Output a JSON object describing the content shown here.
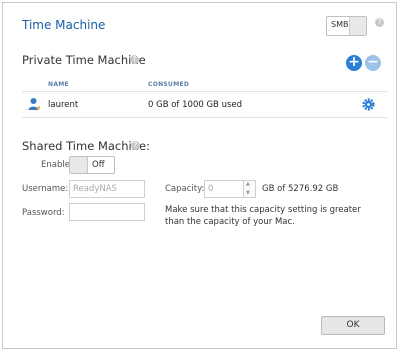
{
  "window": {
    "title": "Time Machine"
  },
  "protocol_toggle": {
    "label": "SMB",
    "help": "?"
  },
  "private": {
    "title": "Private Time Machine",
    "help": "?",
    "add_symbol": "+",
    "remove_symbol": "−",
    "columns": [
      "NAME",
      "CONSUMED"
    ],
    "rows": [
      {
        "name": "laurent",
        "consumed": "0 GB of 1000 GB used"
      }
    ]
  },
  "shared": {
    "title": "Shared Time Machine:",
    "help": "?",
    "enable_label": "Enable",
    "enable_state": "Off",
    "username_label": "Username:",
    "username_value": "ReadyNAS",
    "password_label": "Password:",
    "password_value": "",
    "capacity_label": "Capacity:",
    "capacity_value": "0",
    "capacity_suffix": "GB of 5276.92 GB",
    "note": "Make sure that this capacity setting is greater than the capacity of your Mac."
  },
  "footer": {
    "ok_label": "OK"
  },
  "colors": {
    "accent": "#1a5ea8",
    "add": "#2a7fd4",
    "remove": "#9cc3ea"
  }
}
